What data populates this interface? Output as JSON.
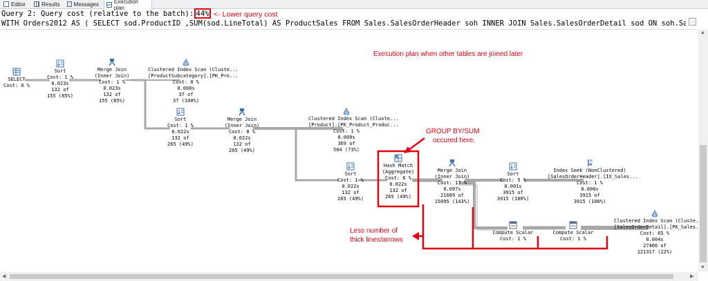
{
  "tabs": [
    {
      "label": "Editor",
      "icon": "editor-icon"
    },
    {
      "label": "Results",
      "icon": "results-grid-icon"
    },
    {
      "label": "Messages",
      "icon": "messages-icon"
    },
    {
      "label": "Execution plan",
      "icon": "execution-plan-icon",
      "active": true
    }
  ],
  "query": {
    "line1": "Query 2: Query cost (relative to the batch):",
    "cost_percent": "44%",
    "sql": "WITH Orders2012 AS ( SELECT sod.ProductID ,SUM(sod.LineTotal) AS ProductSales FROM Sales.SalesOrderHeader soh INNER JOIN Sales.SalesOrderDetail sod ON soh.Sale..."
  },
  "annotations": {
    "lower_cost": "<- Lower query cost",
    "plan_note": "Execution plan when other tables are joined later",
    "groupby_line1": "GROUP BY/SUM",
    "groupby_line2": "occured here.",
    "lines_line1": "Less number of",
    "lines_line2": "thick lines/arrows"
  },
  "colors": {
    "annotation": "#e3000f",
    "plan_line": "#a8a8a8",
    "icon_blue": "#3a6fb0"
  },
  "nodes": {
    "select": {
      "lines": [
        "SELECT",
        "Cost: 0 %"
      ],
      "icon": "select-icon"
    },
    "sort1": {
      "lines": [
        "Sort",
        "Cost: 1 %",
        "0.023s",
        "132 of",
        "155 (85%)"
      ],
      "icon": "sort-icon"
    },
    "merge1": {
      "lines": [
        "Merge Join",
        "(Inner Join)",
        "Cost: 1 %",
        "0.023s",
        "132 of",
        "155 (85%)"
      ],
      "icon": "merge-join-icon"
    },
    "cis_subcat": {
      "lines": [
        "Clustered Index Scan (Cluste...",
        "[ProductSubcategory].[PK_Pro...",
        "Cost: 0 %",
        "0.000s",
        "37 of",
        "37 (100%)"
      ],
      "icon": "clustered-index-scan-icon"
    },
    "sort2": {
      "lines": [
        "Sort",
        "Cost: 1 %",
        "0.022s",
        "132 of",
        "265 (49%)"
      ],
      "icon": "sort-icon"
    },
    "merge2": {
      "lines": [
        "Merge Join",
        "(Inner Join)",
        "Cost: 0 %",
        "0.022s",
        "132 of",
        "265 (49%)"
      ],
      "icon": "merge-join-icon"
    },
    "cis_product": {
      "lines": [
        "Clustered Index Scan (Cluste...",
        "[Product].[PK_Product_Produc...",
        "Cost: 1 %",
        "0.000s",
        "369 of",
        "504 (73%)"
      ],
      "icon": "clustered-index-scan-icon"
    },
    "sort3": {
      "lines": [
        "Sort",
        "Cost: 1 %",
        "0.022s",
        "132 of",
        "265 (49%)"
      ],
      "icon": "sort-icon"
    },
    "hash": {
      "lines": [
        "Hash Match",
        "(Aggregate)",
        "Cost: 6 %",
        "0.022s",
        "132 of",
        "265 (49%)"
      ],
      "icon": "hash-match-icon"
    },
    "merge3": {
      "lines": [
        "Merge Join",
        "(Inner Join)",
        "Cost: 17 %",
        "0.007s",
        "21689 of",
        "15095 (143%)"
      ],
      "icon": "merge-join-icon"
    },
    "sort4": {
      "lines": [
        "Sort",
        "Cost: 5 %",
        "0.001s",
        "3915 of",
        "3915 (100%)"
      ],
      "icon": "sort-icon"
    },
    "seek": {
      "lines": [
        "Index Seek (NonClustered)",
        "[SalesOrderHeader].[IX_Sales...",
        "Cost: 1 %",
        "0.000s",
        "3915 of",
        "3915 (100%)"
      ],
      "icon": "index-seek-icon"
    },
    "cs1": {
      "lines": [
        "Compute Scalar",
        "Cost: 1 %"
      ],
      "icon": "compute-scalar-icon"
    },
    "cs2": {
      "lines": [
        "Compute Scalar",
        "Cost: 1 %"
      ],
      "icon": "compute-scalar-icon"
    },
    "cis_detail": {
      "lines": [
        "Clustered Index Scan (Cluste...",
        "[SalesOrderDetail].[PK_Sales...",
        "Cost: 65 %",
        "0.004s",
        "27406 of",
        "121317 (22%)"
      ],
      "icon": "clustered-index-scan-icon"
    }
  }
}
